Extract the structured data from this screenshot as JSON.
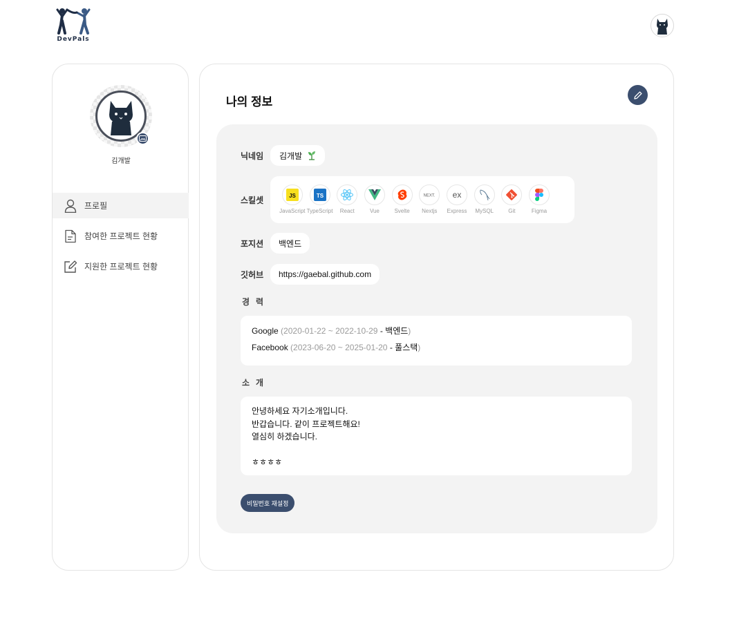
{
  "header": {
    "logo_text": "DevPals",
    "avatar_icon": "cat-avatar-icon"
  },
  "sidebar": {
    "user_name": "김개발",
    "items": [
      {
        "label": "프로필",
        "icon": "user-icon",
        "active": true
      },
      {
        "label": "참여한 프로젝트 현황",
        "icon": "document-icon",
        "active": false
      },
      {
        "label": "지원한 프로젝트 현황",
        "icon": "edit-square-icon",
        "active": false
      }
    ]
  },
  "main": {
    "title": "나의 정보",
    "labels": {
      "nickname": "닉네임",
      "skills": "스킬셋",
      "position": "포지션",
      "github": "깃허브",
      "career": "경력",
      "intro": "소개"
    },
    "nickname": "김개발",
    "position": "백엔드",
    "github": "https://gaebal.github.com",
    "skills": [
      {
        "name": "JavaScript",
        "icon": "javascript-icon"
      },
      {
        "name": "TypeScript",
        "icon": "typescript-icon"
      },
      {
        "name": "React",
        "icon": "react-icon"
      },
      {
        "name": "Vue",
        "icon": "vue-icon"
      },
      {
        "name": "Svelte",
        "icon": "svelte-icon"
      },
      {
        "name": "Nextjs",
        "icon": "nextjs-icon"
      },
      {
        "name": "Express",
        "icon": "express-icon"
      },
      {
        "name": "MySQL",
        "icon": "mysql-icon"
      },
      {
        "name": "Git",
        "icon": "git-icon"
      },
      {
        "name": "Figma",
        "icon": "figma-icon"
      }
    ],
    "career": [
      {
        "company": "Google",
        "period": "(2020-01-22 ~ 2022-10-29",
        "dash": " - ",
        "role": "백엔드",
        "close": ")"
      },
      {
        "company": "Facebook",
        "period": "(2023-06-20 ~ 2025-01-20",
        "dash": " - ",
        "role": "풀스택",
        "close": ")"
      }
    ],
    "intro_lines": [
      "안녕하세요 자기소개입니다.",
      "반갑습니다. 같이 프로젝트해요!",
      "열심히 하겠습니다.",
      "",
      "ㅎㅎㅎㅎ"
    ],
    "password_button": "비밀번호 재설정"
  },
  "colors": {
    "accent": "#3b4e6e",
    "card_bg": "#f3f3f3"
  }
}
